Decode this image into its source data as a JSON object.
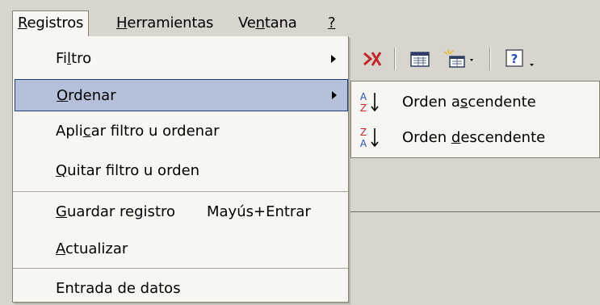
{
  "menubar": {
    "items": [
      {
        "pre": "",
        "u": "R",
        "post": "egistros"
      },
      {
        "pre": "",
        "u": "H",
        "post": "erramientas"
      },
      {
        "pre": "Ve",
        "u": "n",
        "post": "tana"
      },
      {
        "pre": "",
        "u": "?",
        "post": ""
      }
    ]
  },
  "menu": {
    "items": [
      {
        "pre": "Fi",
        "u": "l",
        "post": "tro"
      },
      {
        "pre": "",
        "u": "O",
        "post": "rdenar"
      },
      {
        "pre": "Apli",
        "u": "c",
        "post": "ar filtro u ordenar"
      },
      {
        "pre": "",
        "u": "Q",
        "post": "uitar filtro u orden"
      },
      {
        "pre": "",
        "u": "G",
        "post": "uardar registro",
        "shortcut": "Mayús+Entrar"
      },
      {
        "pre": "",
        "u": "A",
        "post": "ctualizar"
      },
      {
        "pre": "Entrada de datos",
        "u": "",
        "post": ""
      }
    ]
  },
  "submenu": {
    "items": [
      {
        "pre": "Orden a",
        "u": "s",
        "post": "cendente",
        "icon_top": "A",
        "icon_bottom": "Z"
      },
      {
        "pre": "Orden ",
        "u": "d",
        "post": "escendente",
        "icon_top": "Z",
        "icon_bottom": "A"
      }
    ]
  },
  "toolbar": {
    "icons": [
      "delete-record-icon",
      "database-window-icon",
      "new-object-icon",
      "help-icon"
    ]
  },
  "colors": {
    "highlight": "#b5c1db",
    "highlight_border": "#1f3d7a",
    "menu_bg": "#f7f6f3",
    "chrome": "#d8d5ce",
    "sort_red": "#c0262a",
    "sort_blue": "#2a4fb0"
  }
}
